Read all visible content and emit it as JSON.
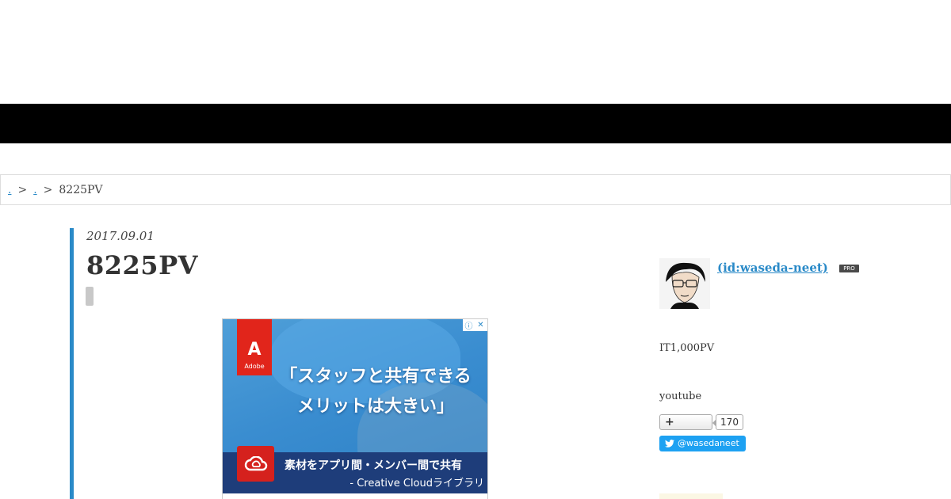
{
  "breadcrumb": {
    "items": [
      ".",
      "."
    ],
    "separator": ">",
    "current": "8225PV"
  },
  "article": {
    "date": "2017.09.01",
    "title": "8225PV"
  },
  "ad": {
    "logo_mark": "A",
    "logo_brand": "Adobe",
    "headline_line1": "「スタッフと共有できる",
    "headline_line2": "メリットは大きい」",
    "subline": "素材をアプリ間・メンバー間で共有",
    "subline2": "- Creative Cloudライブラリ",
    "info_icon": "ⓘ",
    "close_icon": "✕"
  },
  "sidebar": {
    "author": " (id:waseda-neet)",
    "pro_badge": "PRO",
    "profile_text": "IT1,000PV",
    "youtube_text": "youtube",
    "follow_label": "+",
    "follow_count": "170",
    "twitter_label": "@wasedaneet"
  },
  "colors": {
    "accent": "#2a8ac8",
    "nav": "#000000",
    "twitter": "#1da1f2",
    "adobe_red": "#e1251b"
  }
}
